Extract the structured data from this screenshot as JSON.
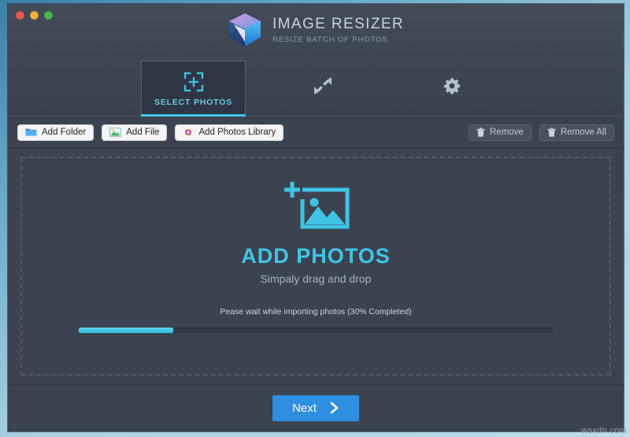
{
  "app": {
    "brand_title": "IMAGE RESIZER",
    "brand_subtitle": "RESIZE BATCH OF PHOTOS",
    "logo_icon": "cube-logo-icon",
    "accent_cyan": "#3fc4e6",
    "accent_blue": "#2e8fe0",
    "window_bg": "#3b4350"
  },
  "titlebar": {
    "close_icon": "close-traffic-light-icon",
    "minimize_icon": "minimize-traffic-light-icon",
    "zoom_icon": "zoom-traffic-light-icon"
  },
  "tabs": [
    {
      "label": "SELECT PHOTOS",
      "icon": "focus-frame-plus-icon",
      "selected": true
    },
    {
      "label": "",
      "icon": "resize-diagonal-arrows-icon",
      "selected": false
    },
    {
      "label": "",
      "icon": "gear-icon",
      "selected": false
    }
  ],
  "toolbar": {
    "left_buttons": [
      {
        "label": "Add Folder",
        "icon": "folder-icon"
      },
      {
        "label": "Add File",
        "icon": "picture-icon"
      },
      {
        "label": "Add Photos Library",
        "icon": "photos-library-icon"
      }
    ],
    "right_buttons": [
      {
        "label": "Remove",
        "icon": "trash-icon"
      },
      {
        "label": "Remove All",
        "icon": "trash-icon"
      }
    ]
  },
  "dropzone": {
    "icon": "add-photo-icon",
    "title": "ADD PHOTOS",
    "subtitle": "Simpaly drag and drop"
  },
  "progress": {
    "label": "Pease wait while importing photos (30% Completed)",
    "percent": 30,
    "fill_width_percent": 20,
    "fill_color": "#3fc4e6",
    "track_color": "#333a46"
  },
  "footer": {
    "next_label": "Next",
    "next_icon": "chevron-right-icon"
  },
  "watermark": {
    "text": "wsxdn.com"
  }
}
